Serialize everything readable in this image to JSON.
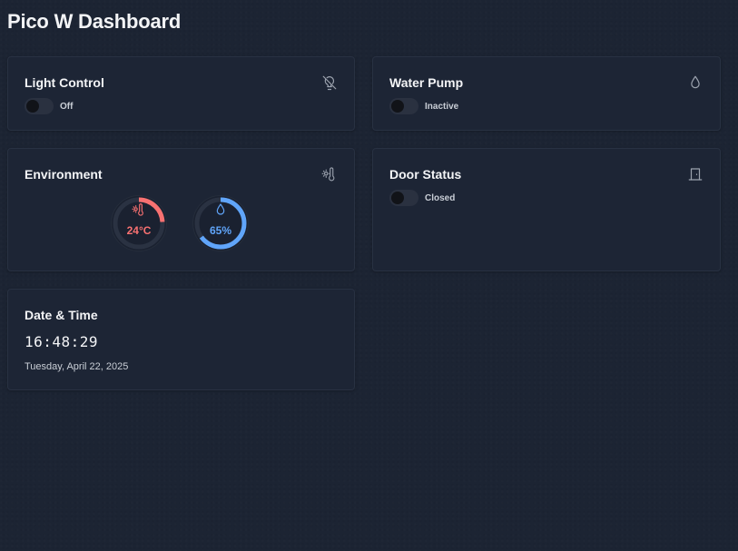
{
  "page": {
    "title": "Pico W Dashboard"
  },
  "light": {
    "title": "Light Control",
    "status": "Off",
    "on": false,
    "icon": "lightbulb-off-icon"
  },
  "pump": {
    "title": "Water Pump",
    "status": "Inactive",
    "on": false,
    "icon": "droplet-icon"
  },
  "environment": {
    "title": "Environment",
    "icon": "sun-thermometer-icon",
    "temperature": {
      "value": "24°C",
      "level": 0.24,
      "color": "#f87171",
      "icon": "sun-thermometer-icon"
    },
    "humidity": {
      "value": "65%",
      "level": 0.65,
      "color": "#60a5fa",
      "icon": "droplet-icon"
    }
  },
  "door": {
    "title": "Door Status",
    "status": "Closed",
    "on": false,
    "icon": "door-closed-icon"
  },
  "datetime": {
    "title": "Date & Time",
    "time": "16:48:29",
    "date": "Tuesday, April 22, 2025"
  },
  "colors": {
    "background": "#1c2433",
    "card": "#1d2535",
    "temperature": "#f87171",
    "humidity": "#60a5fa",
    "icon": "#9ca3af"
  }
}
